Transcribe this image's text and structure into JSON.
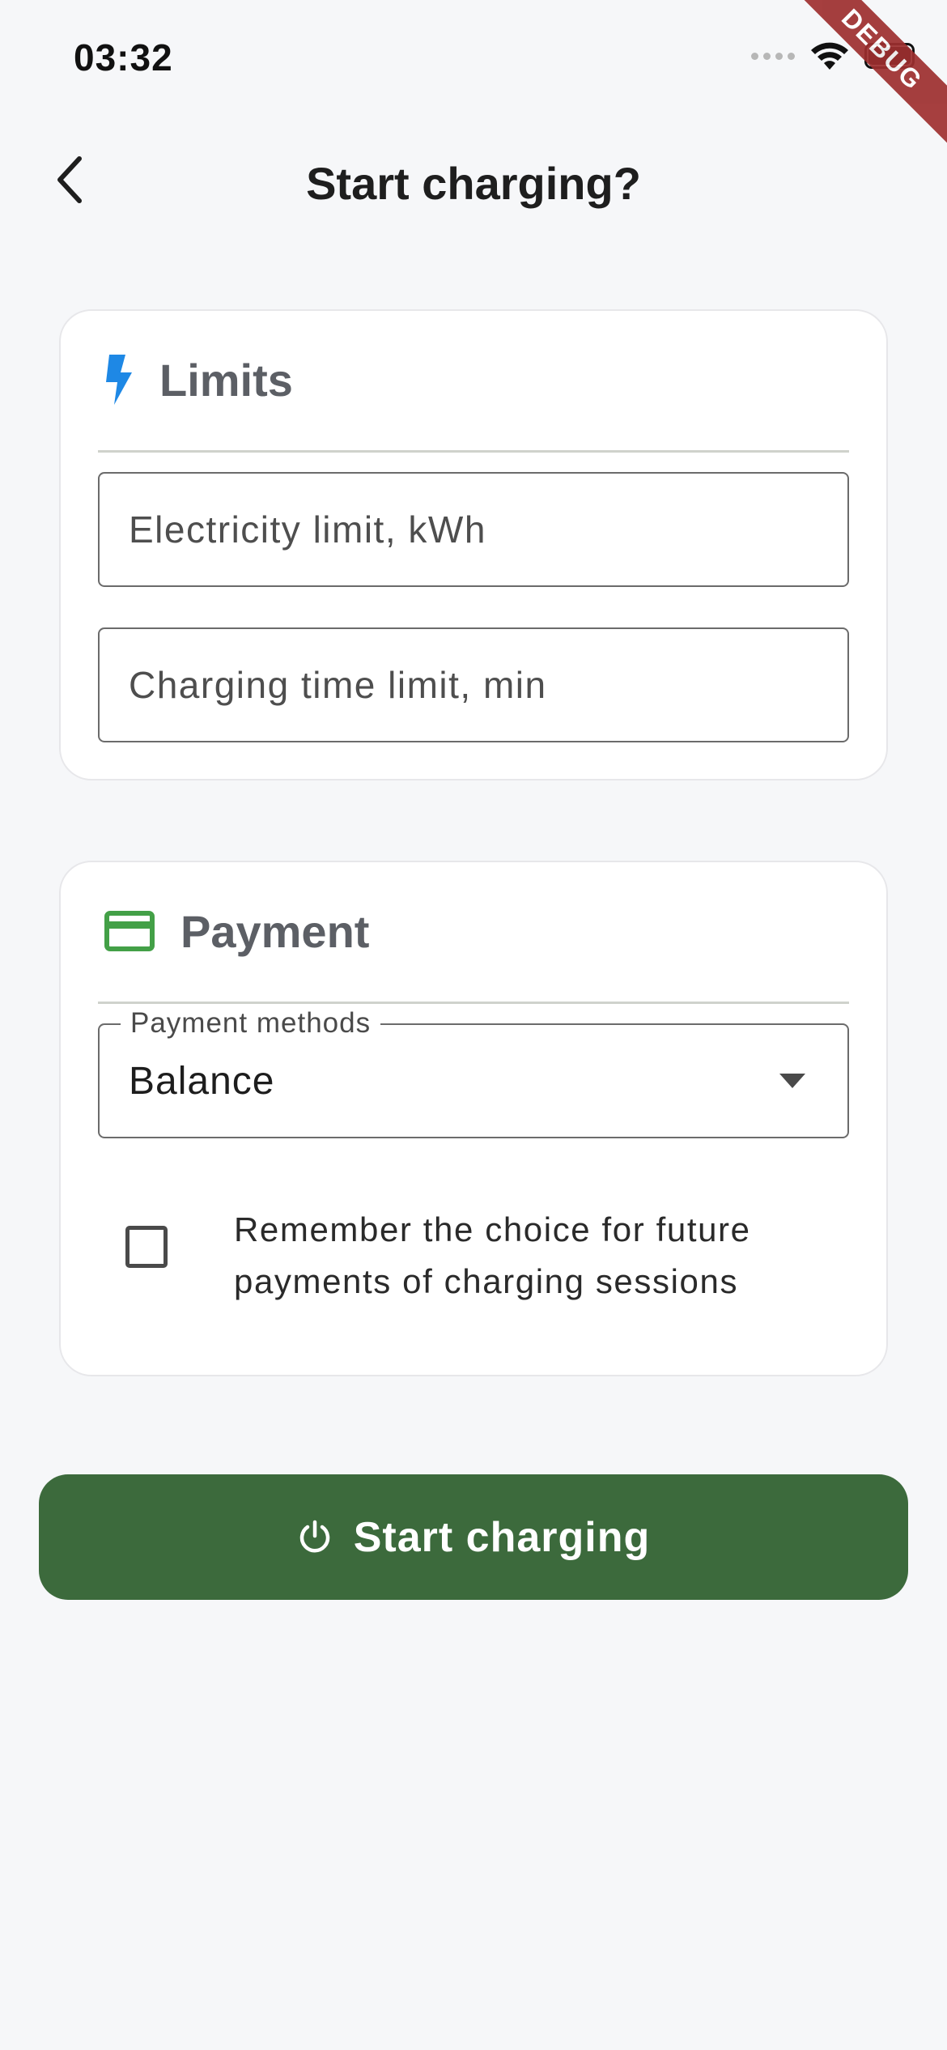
{
  "status_bar": {
    "time": "03:32",
    "debug_label": "DEBUG"
  },
  "header": {
    "title": "Start charging?"
  },
  "limits": {
    "title": "Limits",
    "electricity_placeholder": "Electricity limit, kWh",
    "time_placeholder": "Charging time limit, min"
  },
  "payment": {
    "title": "Payment",
    "methods_label": "Payment methods",
    "selected_method": "Balance",
    "remember_label": "Remember the choice for future payments of charging sessions",
    "remember_checked": false
  },
  "action": {
    "start_label": "Start charging"
  },
  "colors": {
    "accent_green": "#3c6a3c",
    "bolt_blue": "#1e88e5",
    "card_icon_green": "#43a047",
    "debug_ribbon": "#9e2f2f"
  },
  "icons": {
    "back": "chevron-left-icon",
    "limits": "lightning-bolt-icon",
    "payment": "credit-card-icon",
    "dropdown": "caret-down-icon",
    "start": "power-icon"
  }
}
